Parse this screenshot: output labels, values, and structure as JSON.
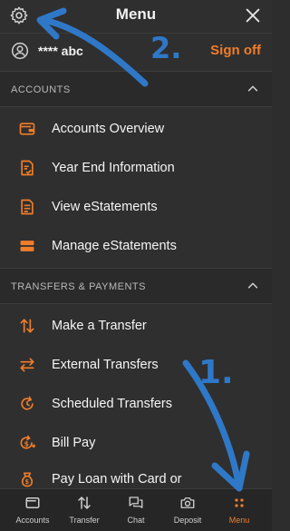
{
  "header": {
    "title": "Menu"
  },
  "user": {
    "name": "**** abc",
    "signoff": "Sign off"
  },
  "sections": [
    {
      "label": "ACCOUNTS"
    },
    {
      "label": "TRANSFERS & PAYMENTS"
    }
  ],
  "accounts_items": [
    {
      "label": "Accounts Overview",
      "icon": "wallet-icon"
    },
    {
      "label": "Year End Information",
      "icon": "document-check-icon"
    },
    {
      "label": "View eStatements",
      "icon": "document-icon"
    },
    {
      "label": "Manage eStatements",
      "icon": "stack-icon"
    }
  ],
  "transfer_items": [
    {
      "label": "Make a Transfer",
      "icon": "swap-vertical-icon"
    },
    {
      "label": "External Transfers",
      "icon": "swap-horizontal-icon"
    },
    {
      "label": "Scheduled Transfers",
      "icon": "scheduled-icon"
    },
    {
      "label": "Bill Pay",
      "icon": "bill-pay-icon"
    },
    {
      "label": "Pay Loan with Card or",
      "icon": "loan-icon"
    }
  ],
  "bottom_nav": [
    {
      "label": "Accounts",
      "icon": "accounts-icon"
    },
    {
      "label": "Transfer",
      "icon": "transfer-icon"
    },
    {
      "label": "Chat",
      "icon": "chat-icon"
    },
    {
      "label": "Deposit",
      "icon": "camera-icon"
    },
    {
      "label": "Menu",
      "icon": "menu-dots-icon"
    }
  ],
  "annotations": {
    "first": "1.",
    "second": "2."
  },
  "colors": {
    "accent": "#ef7d2a",
    "background": "#2f2f2f",
    "annotation": "#2f78c8"
  }
}
